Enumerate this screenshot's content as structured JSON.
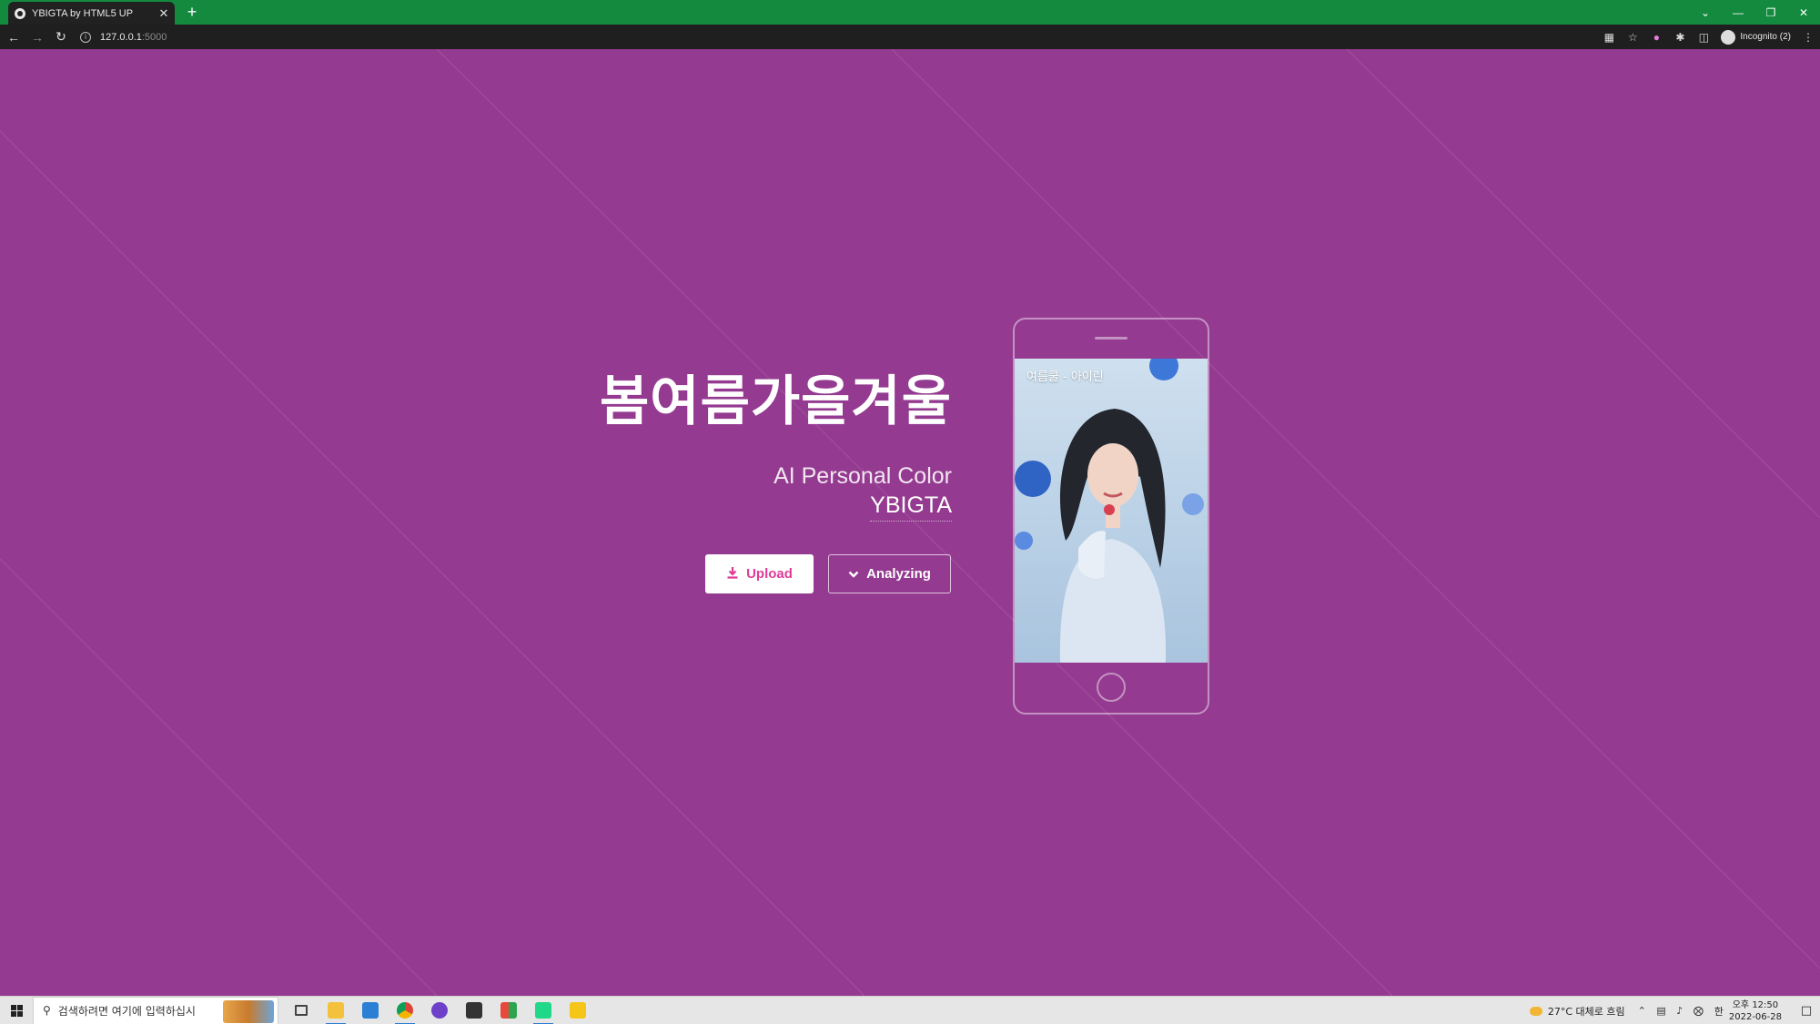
{
  "browser": {
    "tab_title": "YBIGTA by HTML5 UP",
    "tab_close": "✕",
    "new_tab": "+",
    "url_host": "127.0.0.1",
    "url_port": ":5000",
    "profile_label": "Incognito (2)",
    "window_controls": [
      "⌄",
      "—",
      "❐",
      "✕"
    ]
  },
  "hero": {
    "title": "봄여름가을겨울",
    "subtitle": "AI Personal Color",
    "name": "YBIGTA"
  },
  "actions": {
    "upload_label": "Upload",
    "upload_icon": "download-icon",
    "analyze_label": "Analyzing",
    "analyze_icon": "chevron-down-icon"
  },
  "phone": {
    "caption": "여름쿨 - 아이린"
  },
  "taskbar": {
    "search_placeholder": "검색하려면 여기에 입력하십시",
    "weather": "27°C  대체로 흐림",
    "ime": "한",
    "time": "오후 12:50",
    "date": "2022-06-28"
  },
  "colors": {
    "page_bg": "#943a90",
    "accent": "#e03c97",
    "tabbar": "#138a3e"
  }
}
